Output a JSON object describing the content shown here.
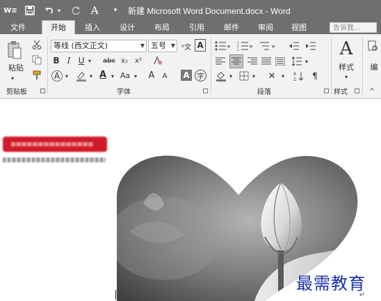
{
  "title_bar": {
    "document_title": "新建 Microsoft Word Document.docx - Word",
    "quick_access": [
      "word-logo-icon",
      "save-icon",
      "undo-icon",
      "redo-icon",
      "format-painter-icon",
      "customize-qat-icon"
    ]
  },
  "tabs": [
    {
      "label": "文件",
      "active": false
    },
    {
      "label": "开始",
      "active": true
    },
    {
      "label": "插入",
      "active": false
    },
    {
      "label": "设计",
      "active": false
    },
    {
      "label": "布局",
      "active": false
    },
    {
      "label": "引用",
      "active": false
    },
    {
      "label": "邮件",
      "active": false
    },
    {
      "label": "审阅",
      "active": false
    },
    {
      "label": "视图",
      "active": false
    }
  ],
  "search": {
    "placeholder": "告诉我..."
  },
  "ribbon": {
    "clipboard": {
      "paste_label": "粘贴",
      "group_label": "剪贴板"
    },
    "font": {
      "font_name": "等线 (西文正文)",
      "font_size": "五号",
      "group_label": "字体",
      "buttons": {
        "bold": "B",
        "italic": "I",
        "underline": "U",
        "strike": "abc",
        "subscript": "x₂",
        "superscript": "x²",
        "char_case": "Aa",
        "grow": "A",
        "shrink": "A",
        "clear": "A",
        "highlight": "A",
        "char_border": "A",
        "font_color": "A",
        "encircle": "字",
        "phonetic": "ᵃ文",
        "text_effect": "A"
      }
    },
    "paragraph": {
      "group_label": "段落"
    },
    "styles": {
      "styles_label": "样式",
      "group_label": "样式"
    },
    "editing": {
      "label": "编"
    }
  },
  "document": {
    "watermark_text": "最需教育",
    "paragraph_mark": "↵"
  },
  "colors": {
    "title_bar": "#6f6f6f",
    "ribbon": "#f2f2f2",
    "accent_red": "#d01a25",
    "watermark_blue": "#1b2fa8"
  }
}
